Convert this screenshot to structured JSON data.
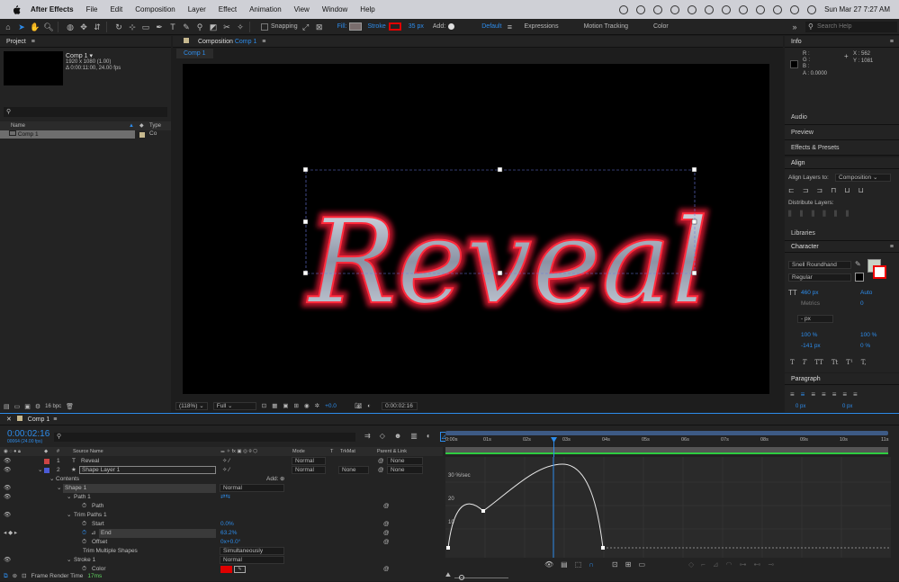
{
  "menubar": {
    "app_name": "After Effects",
    "items": [
      "File",
      "Edit",
      "Composition",
      "Layer",
      "Effect",
      "Animation",
      "View",
      "Window",
      "Help"
    ],
    "clock": "Sun Mar 27  7:27 AM"
  },
  "toolbar": {
    "snapping_label": "Snapping",
    "fill_label": "Fill:",
    "stroke_label": "Stroke",
    "stroke_width": "35 px",
    "add_label": "Add:",
    "workspaces": [
      "Default",
      "Expressions",
      "Motion Tracking",
      "Color"
    ],
    "search_placeholder": "Search Help",
    "colors": {
      "fill": "#7a6d6d",
      "stroke": "#e00000"
    }
  },
  "project": {
    "title": "Project",
    "comp_name": "Comp 1 ▾",
    "comp_size": "1920 x 1080 (1.00)",
    "comp_duration": "Δ 0:00:11:00, 24.00 fps",
    "col_name": "Name",
    "col_type": "Type",
    "item_name": "Comp 1",
    "item_type": "Co",
    "bpc": "16 bpc"
  },
  "composition": {
    "tab_prefix": "Composition",
    "tab_name": "Comp 1",
    "sub_tab": "Comp 1",
    "text": "Reveal",
    "zoom": "(118%)",
    "resolution": "Full",
    "exposure": "+0.0",
    "timecode": "0:00:02:16"
  },
  "info": {
    "title": "Info",
    "r": "R :",
    "g": "G :",
    "b": "B :",
    "a": "A : 0.0000",
    "x": "X : 562",
    "y": "Y : 1081"
  },
  "side_panels": [
    "Audio",
    "Preview",
    "Effects & Presets"
  ],
  "align": {
    "title": "Align",
    "align_to_label": "Align Layers to:",
    "align_to_value": "Composition",
    "distribute_label": "Distribute Layers:"
  },
  "libraries": "Libraries",
  "character": {
    "title": "Character",
    "font": "Snell Roundhand",
    "style": "Regular",
    "size": "460 px",
    "leading": "Auto",
    "kerning": "Metrics",
    "tracking": "0",
    "stroke_unit": "- px",
    "vscale": "100 %",
    "hscale": "100 %",
    "baseline": "-141 px",
    "tsume": "0 %",
    "style_buttons": [
      "T",
      "T",
      "TT",
      "Tt",
      "T¹",
      "T,"
    ],
    "fill_color": "#c7d3c6"
  },
  "paragraph": {
    "title": "Paragraph",
    "indent_left": "0 px",
    "indent_right": "0 px"
  },
  "timeline": {
    "tab": "Comp 1",
    "timecode": "0:00:02:16",
    "frame_info": "00064 (24.00 fps)",
    "columns": {
      "source": "Source Name",
      "mode": "Mode",
      "t": "T",
      "trkmat": "TrkMat",
      "parent": "Parent & Link"
    },
    "layers": [
      {
        "num": "1",
        "name": "Reveal",
        "type": "T",
        "mode": "Normal",
        "trkmat": "",
        "parent": "None",
        "color": "#c44"
      },
      {
        "num": "2",
        "name": "Shape Layer 1",
        "type": "★",
        "mode": "Normal",
        "trkmat": "None",
        "parent": "None",
        "color": "#4b5bd6"
      }
    ],
    "props": {
      "contents": "Contents",
      "add": "Add:",
      "shape1": "Shape 1",
      "shape1_mode": "Normal",
      "path1": "Path 1",
      "path": "Path",
      "trim": "Trim Paths 1",
      "start": "Start",
      "start_val": "0.0%",
      "end": "End",
      "end_val": "63.2%",
      "offset": "Offset",
      "offset_val": "0x+0.0°",
      "trim_multi": "Trim Multiple Shapes",
      "trim_multi_val": "Simultaneously",
      "stroke1": "Stroke 1",
      "stroke1_mode": "Normal",
      "color": "Color"
    },
    "render_label": "Frame Render Time",
    "render_value": "17ms",
    "ruler": [
      "0:00s",
      "01s",
      "02s",
      "03s",
      "04s",
      "05s",
      "06s",
      "07s",
      "08s",
      "09s",
      "10s",
      "11s"
    ],
    "graph_labels": [
      "30 %/sec",
      "20",
      "10"
    ]
  }
}
